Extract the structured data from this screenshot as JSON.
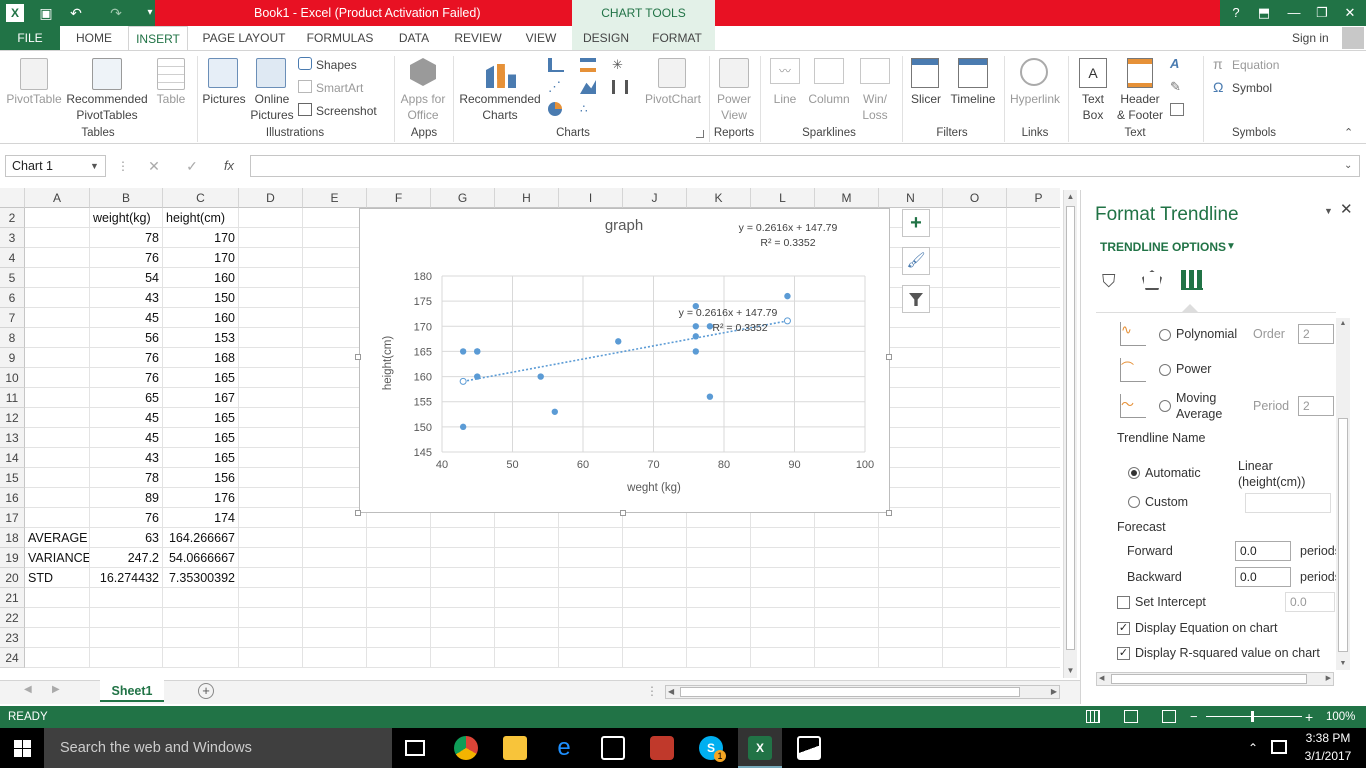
{
  "window": {
    "title": "Book1 -  Excel (Product Activation Failed)",
    "chart_tools": "CHART TOOLS",
    "help": "?",
    "minimize": "—",
    "restore": "❐",
    "close": "✕",
    "signin": "Sign in"
  },
  "tabs": [
    "FILE",
    "HOME",
    "INSERT",
    "PAGE LAYOUT",
    "FORMULAS",
    "DATA",
    "REVIEW",
    "VIEW",
    "DESIGN",
    "FORMAT"
  ],
  "ribbon": {
    "pivottable": "PivotTable",
    "recommended_pivot_1": "Recommended",
    "recommended_pivot_2": "PivotTables",
    "table": "Table",
    "pictures": "Pictures",
    "online_pictures_1": "Online",
    "online_pictures_2": "Pictures",
    "shapes": "Shapes",
    "smartart": "SmartArt",
    "screenshot": "Screenshot",
    "apps_for_office_1": "Apps for",
    "apps_for_office_2": "Office",
    "recommended_charts_1": "Recommended",
    "recommended_charts_2": "Charts",
    "pivotchart": "PivotChart",
    "power_view_1": "Power",
    "power_view_2": "View",
    "line": "Line",
    "column": "Column",
    "winloss_1": "Win/",
    "winloss_2": "Loss",
    "slicer": "Slicer",
    "timeline": "Timeline",
    "hyperlink": "Hyperlink",
    "textbox_1": "Text",
    "textbox_2": "Box",
    "header_footer_1": "Header",
    "header_footer_2": "& Footer",
    "equation": "Equation",
    "symbol": "Symbol",
    "groups": {
      "tables": "Tables",
      "illustrations": "Illustrations",
      "apps": "Apps",
      "charts": "Charts",
      "reports": "Reports",
      "sparklines": "Sparklines",
      "filters": "Filters",
      "links": "Links",
      "text": "Text",
      "symbols": "Symbols"
    }
  },
  "formula_bar": {
    "name_box": "Chart 1",
    "cancel": "✕",
    "enter": "✓",
    "fx": "fx",
    "formula": ""
  },
  "columns": [
    "A",
    "B",
    "C",
    "D",
    "E",
    "F",
    "G",
    "H",
    "I",
    "J",
    "K",
    "L",
    "M",
    "N",
    "O",
    "P"
  ],
  "rows": [
    {
      "n": "2",
      "a": "",
      "b": "weight(kg)",
      "c": "height(cm)"
    },
    {
      "n": "3",
      "a": "",
      "b": "78",
      "c": "170"
    },
    {
      "n": "4",
      "a": "",
      "b": "76",
      "c": "170"
    },
    {
      "n": "5",
      "a": "",
      "b": "54",
      "c": "160"
    },
    {
      "n": "6",
      "a": "",
      "b": "43",
      "c": "150"
    },
    {
      "n": "7",
      "a": "",
      "b": "45",
      "c": "160"
    },
    {
      "n": "8",
      "a": "",
      "b": "56",
      "c": "153"
    },
    {
      "n": "9",
      "a": "",
      "b": "76",
      "c": "168"
    },
    {
      "n": "10",
      "a": "",
      "b": "76",
      "c": "165"
    },
    {
      "n": "11",
      "a": "",
      "b": "65",
      "c": "167"
    },
    {
      "n": "12",
      "a": "",
      "b": "45",
      "c": "165"
    },
    {
      "n": "13",
      "a": "",
      "b": "45",
      "c": "165"
    },
    {
      "n": "14",
      "a": "",
      "b": "43",
      "c": "165"
    },
    {
      "n": "15",
      "a": "",
      "b": "78",
      "c": "156"
    },
    {
      "n": "16",
      "a": "",
      "b": "89",
      "c": "176"
    },
    {
      "n": "17",
      "a": "",
      "b": "76",
      "c": "174"
    },
    {
      "n": "18",
      "a": "AVERAGE",
      "b": "63",
      "c": "164.266667"
    },
    {
      "n": "19",
      "a": "VARIANCE",
      "b": "247.2",
      "c": "54.0666667"
    },
    {
      "n": "20",
      "a": "STD",
      "b": "16.274432",
      "c": "7.35300392"
    },
    {
      "n": "21",
      "a": "",
      "b": "",
      "c": ""
    },
    {
      "n": "22",
      "a": "",
      "b": "",
      "c": ""
    },
    {
      "n": "23",
      "a": "",
      "b": "",
      "c": ""
    },
    {
      "n": "24",
      "a": "",
      "b": "",
      "c": ""
    }
  ],
  "chart_data": {
    "type": "scatter",
    "title": "graph",
    "xlabel": "weght (kg)",
    "ylabel": "height(cm)",
    "xlim": [
      40,
      100
    ],
    "ylim": [
      145,
      180
    ],
    "x_ticks": [
      40,
      50,
      60,
      70,
      80,
      90,
      100
    ],
    "y_ticks": [
      145,
      150,
      155,
      160,
      165,
      170,
      175,
      180
    ],
    "grid": true,
    "points": [
      [
        78,
        170
      ],
      [
        76,
        170
      ],
      [
        54,
        160
      ],
      [
        43,
        150
      ],
      [
        45,
        160
      ],
      [
        56,
        153
      ],
      [
        76,
        168
      ],
      [
        76,
        165
      ],
      [
        65,
        167
      ],
      [
        45,
        165
      ],
      [
        45,
        165
      ],
      [
        43,
        165
      ],
      [
        78,
        156
      ],
      [
        89,
        176
      ],
      [
        76,
        174
      ]
    ],
    "trendline": {
      "type": "linear",
      "slope": 0.2616,
      "intercept": 147.79,
      "x_range": [
        43,
        89
      ]
    },
    "equation_label": "y = 0.2616x + 147.79",
    "r2_label": "R² = 0.3352",
    "marker_color": "#5b9bd5"
  },
  "sheet": {
    "tab": "Sheet1",
    "add": "+"
  },
  "pane": {
    "title": "Format Trendline",
    "section": "TRENDLINE OPTIONS",
    "polynomial": "Polynomial",
    "order_label": "Order",
    "order_value": "2",
    "power": "Power",
    "moving_1": "Moving",
    "moving_2": "Average",
    "period_label": "Period",
    "period_value": "2",
    "trendline_name": "Trendline Name",
    "automatic": "Automatic",
    "auto_value_1": "Linear",
    "auto_value_2": "(height(cm))",
    "custom": "Custom",
    "forecast": "Forecast",
    "forward": "Forward",
    "forward_value": "0.0",
    "backward": "Backward",
    "backward_value": "0.0",
    "period_unit": "periods",
    "set_intercept": "Set Intercept",
    "intercept_value": "0.0",
    "display_equation": "Display Equation on chart",
    "display_r2": "Display R-squared value on chart"
  },
  "status": {
    "ready": "READY",
    "zoom": "100%"
  },
  "taskbar": {
    "search": "Search the web and Windows",
    "time": "3:38 PM",
    "date": "3/1/2017",
    "skype_badge": "1"
  },
  "colors": {
    "excel_green": "#217346",
    "title_red": "#e81123",
    "marker": "#5b9bd5"
  }
}
